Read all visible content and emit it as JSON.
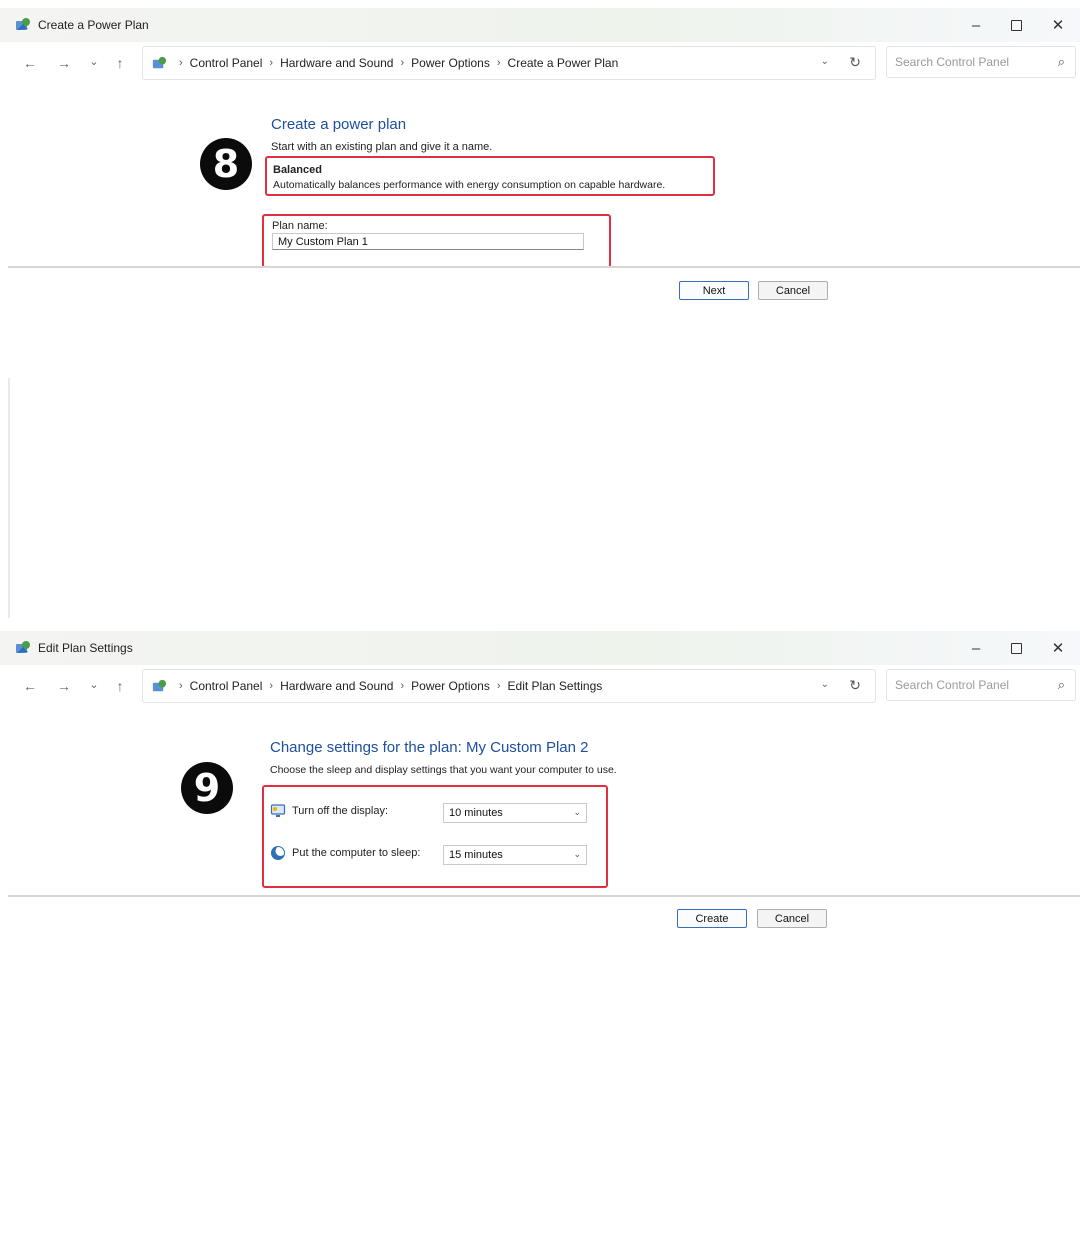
{
  "step8": {
    "badge": "8",
    "window": {
      "title": "Create a Power Plan",
      "controls": {
        "minimize": "–",
        "close": "✕"
      },
      "nav": {
        "back": "←",
        "forward": "→",
        "recent": "⌄",
        "up": "↑"
      },
      "breadcrumb": [
        "Control Panel",
        "Hardware and Sound",
        "Power Options",
        "Create a Power Plan"
      ],
      "search_placeholder": "Search Control Panel"
    },
    "heading": "Create a power plan",
    "subheading": "Start with an existing plan and give it a name.",
    "selected_plan": {
      "name": "Balanced",
      "description": "Automatically balances performance with energy consumption on capable hardware."
    },
    "plan_name_label": "Plan name:",
    "plan_name_value": "My Custom Plan 1",
    "buttons": {
      "next": "Next",
      "cancel": "Cancel"
    }
  },
  "step9": {
    "badge": "9",
    "window": {
      "title": "Edit Plan Settings",
      "controls": {
        "minimize": "–",
        "close": "✕"
      },
      "nav": {
        "back": "←",
        "forward": "→",
        "recent": "⌄",
        "up": "↑"
      },
      "breadcrumb": [
        "Control Panel",
        "Hardware and Sound",
        "Power Options",
        "Edit Plan Settings"
      ],
      "search_placeholder": "Search Control Panel"
    },
    "heading": "Change settings for the plan: My Custom Plan 2",
    "subheading": "Choose the sleep and display settings that you want your computer to use.",
    "settings": [
      {
        "label": "Turn off the display:",
        "value": "10 minutes",
        "icon": "display-icon"
      },
      {
        "label": "Put the computer to sleep:",
        "value": "15 minutes",
        "icon": "sleep-icon"
      }
    ],
    "buttons": {
      "create": "Create",
      "cancel": "Cancel"
    }
  },
  "colors": {
    "link_heading": "#1e4fa0",
    "highlight_box": "#e0303f",
    "badge": "#0b0b0b"
  }
}
